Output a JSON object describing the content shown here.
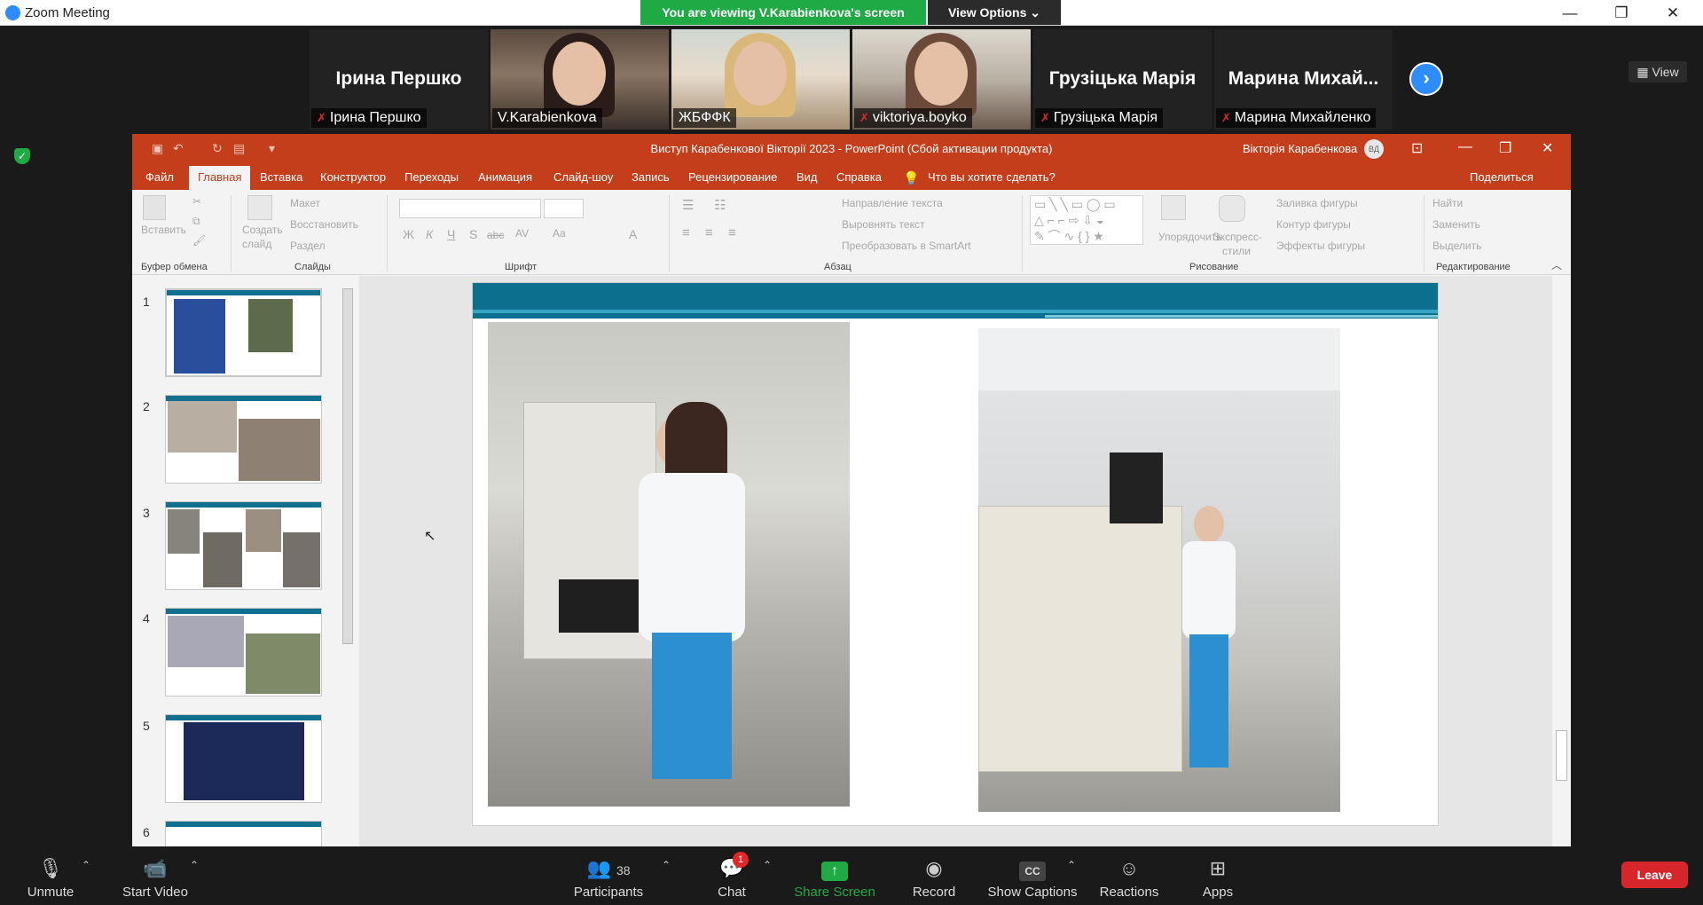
{
  "window": {
    "title": "Zoom Meeting",
    "minimize": "—",
    "restore": "❐",
    "close": "✕"
  },
  "banner": {
    "text": "You are viewing V.Karabienkova's screen",
    "view_options": "View Options ⌄"
  },
  "gallery": {
    "tiles": [
      {
        "big_name": "Ірина Першко",
        "name": "Ірина Першко",
        "muted": true
      },
      {
        "big_name": "",
        "name": "V.Karabienkova",
        "muted": false
      },
      {
        "big_name": "",
        "name": "ЖБФФК",
        "muted": false
      },
      {
        "big_name": "",
        "name": "viktoriya.boyko",
        "muted": true
      },
      {
        "big_name": "Грузіцька Марія",
        "name": "Грузіцька Марія",
        "muted": true
      },
      {
        "big_name": "Марина  Михай...",
        "name": "Марина Михайленко",
        "muted": true
      }
    ],
    "next_arrow": "›",
    "view_button": "▦ View"
  },
  "powerpoint": {
    "doc_title": "Виступ Карабенкової Вікторії 2023  -  PowerPoint (Сбой активации продукта)",
    "user": "Вікторія Карабенкова",
    "avatar_initials": "ВД",
    "menu": [
      "Файл",
      "Главная",
      "Вставка",
      "Конструктор",
      "Переходы",
      "Анимация",
      "Слайд-шоу",
      "Запись",
      "Рецензирование",
      "Вид",
      "Справка"
    ],
    "tell_me": "Что вы хотите сделать?",
    "share": "Поделиться",
    "ribbon": {
      "paste": "Вставить",
      "clipboard_group": "Буфер обмена",
      "new_slide_1": "Создать",
      "new_slide_2": "слайд",
      "layout": "Макет",
      "reset": "Восстановить",
      "section": "Раздел",
      "slides_group": "Слайды",
      "font_group": "Шрифт",
      "text_direction": "Направление текста",
      "align_text": "Выровнять текст",
      "smartart": "Преобразовать в SmartArt",
      "paragraph_group": "Абзац",
      "arrange": "Упорядочить",
      "quick_styles_1": "Экспресс-",
      "quick_styles_2": "стили",
      "shape_fill": "Заливка фигуры",
      "shape_outline": "Контур фигуры",
      "shape_effects": "Эффекты фигуры",
      "drawing_group": "Рисование",
      "find": "Найти",
      "replace": "Заменить",
      "select": "Выделить",
      "editing_group": "Редактирование",
      "font_buttons": [
        "Ж",
        "К",
        "Ч",
        "S",
        "abc",
        "AV",
        "Aa",
        "A"
      ]
    },
    "slide_numbers": [
      "1",
      "2",
      "3",
      "4",
      "5",
      "6"
    ]
  },
  "toolbar": {
    "unmute": "Unmute",
    "start_video": "Start Video",
    "participants": "Participants",
    "participants_count": "38",
    "chat": "Chat",
    "chat_badge": "1",
    "share_screen": "Share Screen",
    "record": "Record",
    "show_captions": "Show Captions",
    "reactions": "Reactions",
    "apps": "Apps",
    "leave": "Leave"
  },
  "colors": {
    "zoom_blue": "#2d8cff",
    "share_green": "#1faa45",
    "ppt_red": "#c43e1c",
    "slide_teal": "#0d6f8e",
    "leave_red": "#d6262b"
  }
}
